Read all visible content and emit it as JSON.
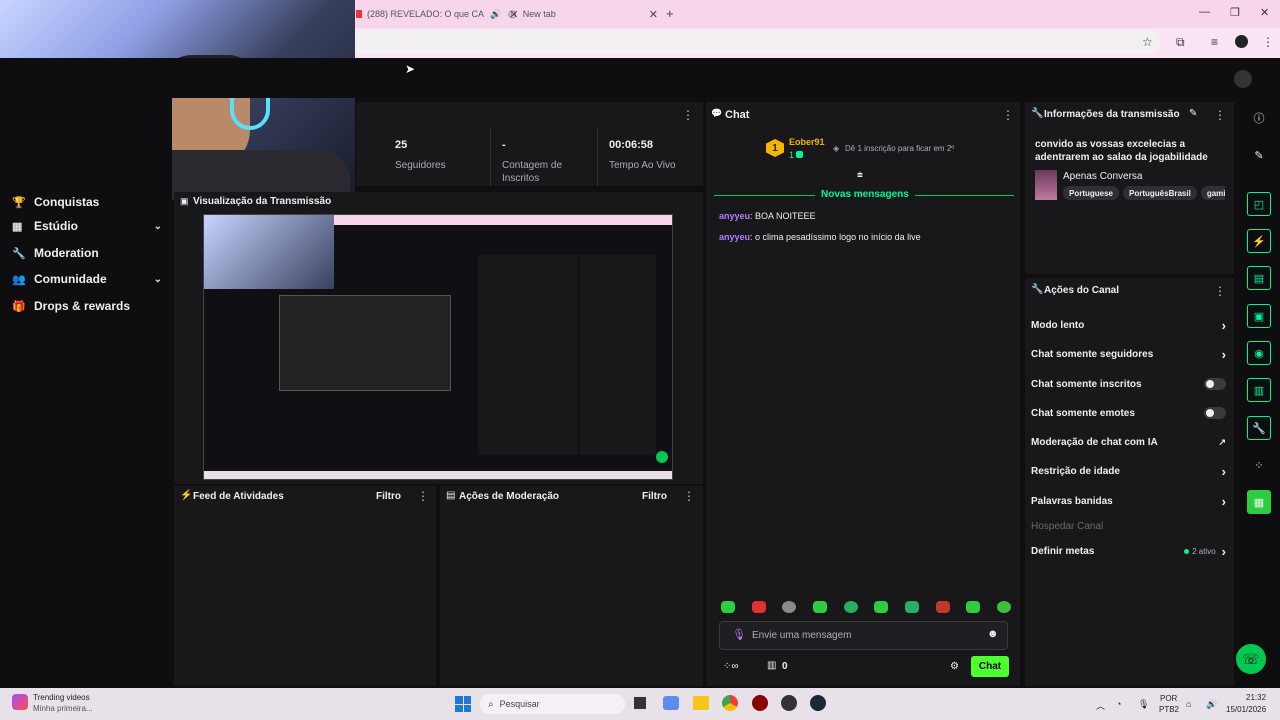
{
  "browser": {
    "tabs": [
      {
        "label": "(288) REVELADO: O que CA"
      },
      {
        "label": "New tab"
      }
    ]
  },
  "sidebar": {
    "items": [
      {
        "label": "Conquistas"
      },
      {
        "label": "Estúdio"
      },
      {
        "label": "Moderation"
      },
      {
        "label": "Comunidade"
      },
      {
        "label": "Drops & rewards"
      }
    ]
  },
  "stats": [
    {
      "value": "25",
      "label": "Seguidores"
    },
    {
      "value": "-",
      "label": "Contagem de Inscritos"
    },
    {
      "value": "00:06:58",
      "label": "Tempo Ao Vivo"
    }
  ],
  "preview": {
    "title": "Visualização da Transmissão"
  },
  "activity": {
    "title": "Feed de Atividades",
    "filter": "Filtro"
  },
  "modactions": {
    "title": "Ações de Moderação",
    "filter": "Filtro"
  },
  "chat": {
    "title": "Chat",
    "leader": {
      "rank": "1",
      "name": "Eober91",
      "count": "1",
      "cta": "Dê 1 inscrição para ficar em 2º"
    },
    "new_messages": "Novas mensagens",
    "messages": [
      {
        "user": "anyyeu",
        "text": ": BOA NOITEEE"
      },
      {
        "user": "anyyeu",
        "text": ": o clima pesadíssimo logo no início da live"
      }
    ],
    "input_placeholder": "Envie uma mensagem",
    "points": "0",
    "send_label": "Chat"
  },
  "stream_info": {
    "title": "Informações da transmissão",
    "stream_title": "convido as vossas excelecias a adentrarem ao salao da jogabilidade",
    "category": "Apenas Conversa",
    "tags": [
      "Portuguese",
      "PortuguêsBrasil",
      "gami"
    ]
  },
  "channel_actions": {
    "title": "Ações do Canal",
    "items": [
      {
        "label": "Modo lento"
      },
      {
        "label": "Chat somente seguidores"
      },
      {
        "label": "Chat somente inscritos"
      },
      {
        "label": "Chat somente emotes"
      },
      {
        "label": "Moderação de chat com IA"
      },
      {
        "label": "Restrição de idade"
      },
      {
        "label": "Palavras banidas"
      },
      {
        "label": "Hospedar Canal"
      },
      {
        "label": "Definir metas"
      }
    ],
    "goals_status": "2 ativo"
  },
  "taskbar": {
    "news_title": "Trending videos",
    "news_sub": "Minha primeira...",
    "search_placeholder": "Pesquisar",
    "lang": "POR",
    "lang_sub": "PTB2",
    "time": "21:32",
    "date": "15/01/2026"
  },
  "colors": {
    "accent": "#00f593",
    "send": "#4dff2e",
    "username": "#b57cff",
    "gold": "#f5b400"
  }
}
